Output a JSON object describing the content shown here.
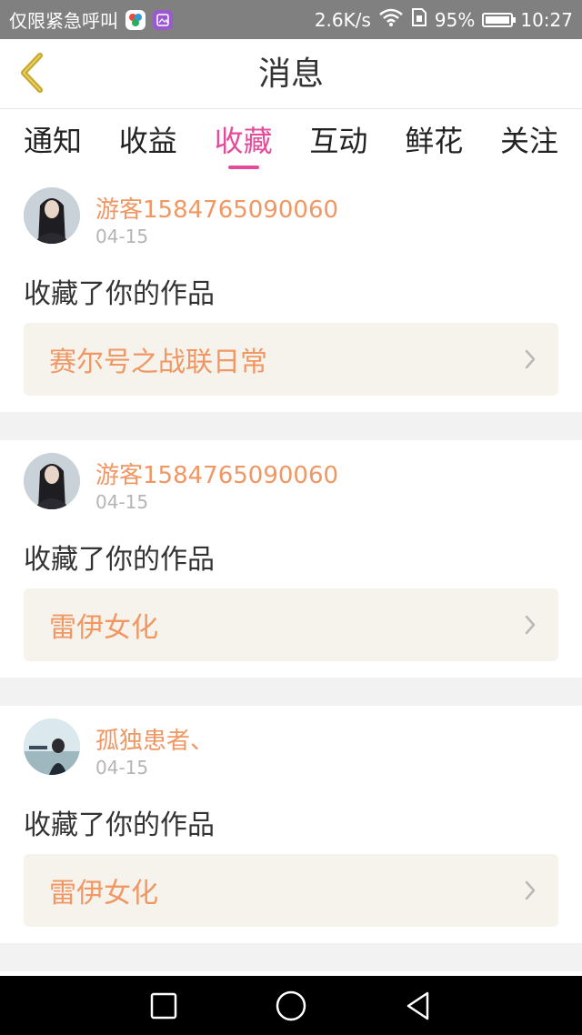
{
  "status_bar": {
    "carrier_text": "仅限紧急呼叫",
    "network_speed": "2.6K/s",
    "battery_percent": "95%",
    "time": "10:27",
    "icons": [
      "app-badge-icon",
      "app-badge-icon",
      "wifi-icon",
      "sim-icon",
      "battery-icon"
    ]
  },
  "header": {
    "title": "消息",
    "back_icon": "chevron-left-icon"
  },
  "tabs": {
    "active_index": 2,
    "items": [
      {
        "label": "通知"
      },
      {
        "label": "收益"
      },
      {
        "label": "收藏"
      },
      {
        "label": "互动"
      },
      {
        "label": "鲜花"
      },
      {
        "label": "关注"
      }
    ]
  },
  "messages": [
    {
      "username": "游客1584765090060",
      "date": "04-15",
      "action": "收藏了你的作品",
      "work_title": "赛尔号之战联日常"
    },
    {
      "username": "游客1584765090060",
      "date": "04-15",
      "action": "收藏了你的作品",
      "work_title": "雷伊女化"
    },
    {
      "username": "孤独患者、",
      "date": "04-15",
      "action": "收藏了你的作品",
      "work_title": "雷伊女化"
    }
  ],
  "nav_bar": {
    "icons": [
      "recent-apps-icon",
      "home-icon",
      "back-icon"
    ]
  },
  "colors": {
    "accent_pink": "#e64b9b",
    "accent_orange": "#f09763",
    "work_box_bg": "#f6f3ec",
    "back_icon": "#c6a52a"
  }
}
